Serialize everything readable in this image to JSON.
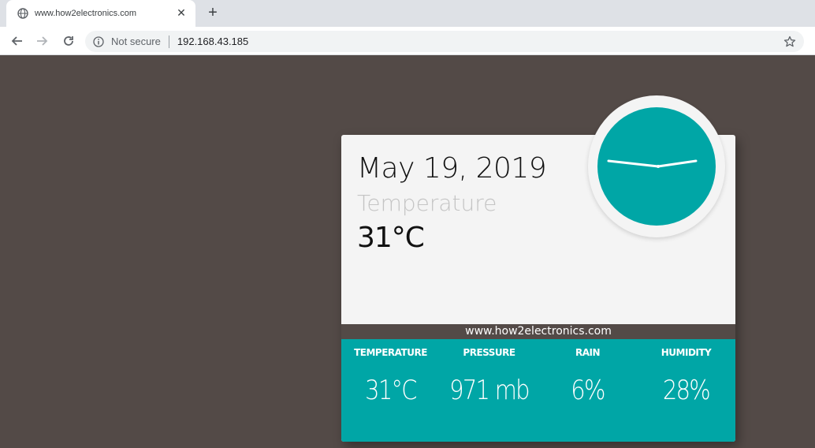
{
  "browser": {
    "tab_title": "www.how2electronics.com",
    "tab_close": "✕",
    "new_tab": "+",
    "security_text": "Not secure",
    "url": "192.168.43.185"
  },
  "card": {
    "date": "May 19, 2019",
    "temperature_label": "Temperature",
    "temperature_value": "31°C",
    "website": "www.how2electronics.com",
    "stats": [
      {
        "label": "TEMPERATURE",
        "value": "31°C"
      },
      {
        "label": "PRESSURE",
        "value": "971 mb"
      },
      {
        "label": "RAIN",
        "value": "6%"
      },
      {
        "label": "HUMIDITY",
        "value": "28%"
      }
    ]
  },
  "colors": {
    "background": "#534a47",
    "accent_teal": "#00a6a6",
    "card": "#f4f4f4"
  },
  "icons": {
    "tab": "globe-icon",
    "back": "arrow-left-icon",
    "forward": "arrow-right-icon",
    "reload": "reload-icon",
    "security": "info-icon",
    "bookmark": "star-icon"
  }
}
